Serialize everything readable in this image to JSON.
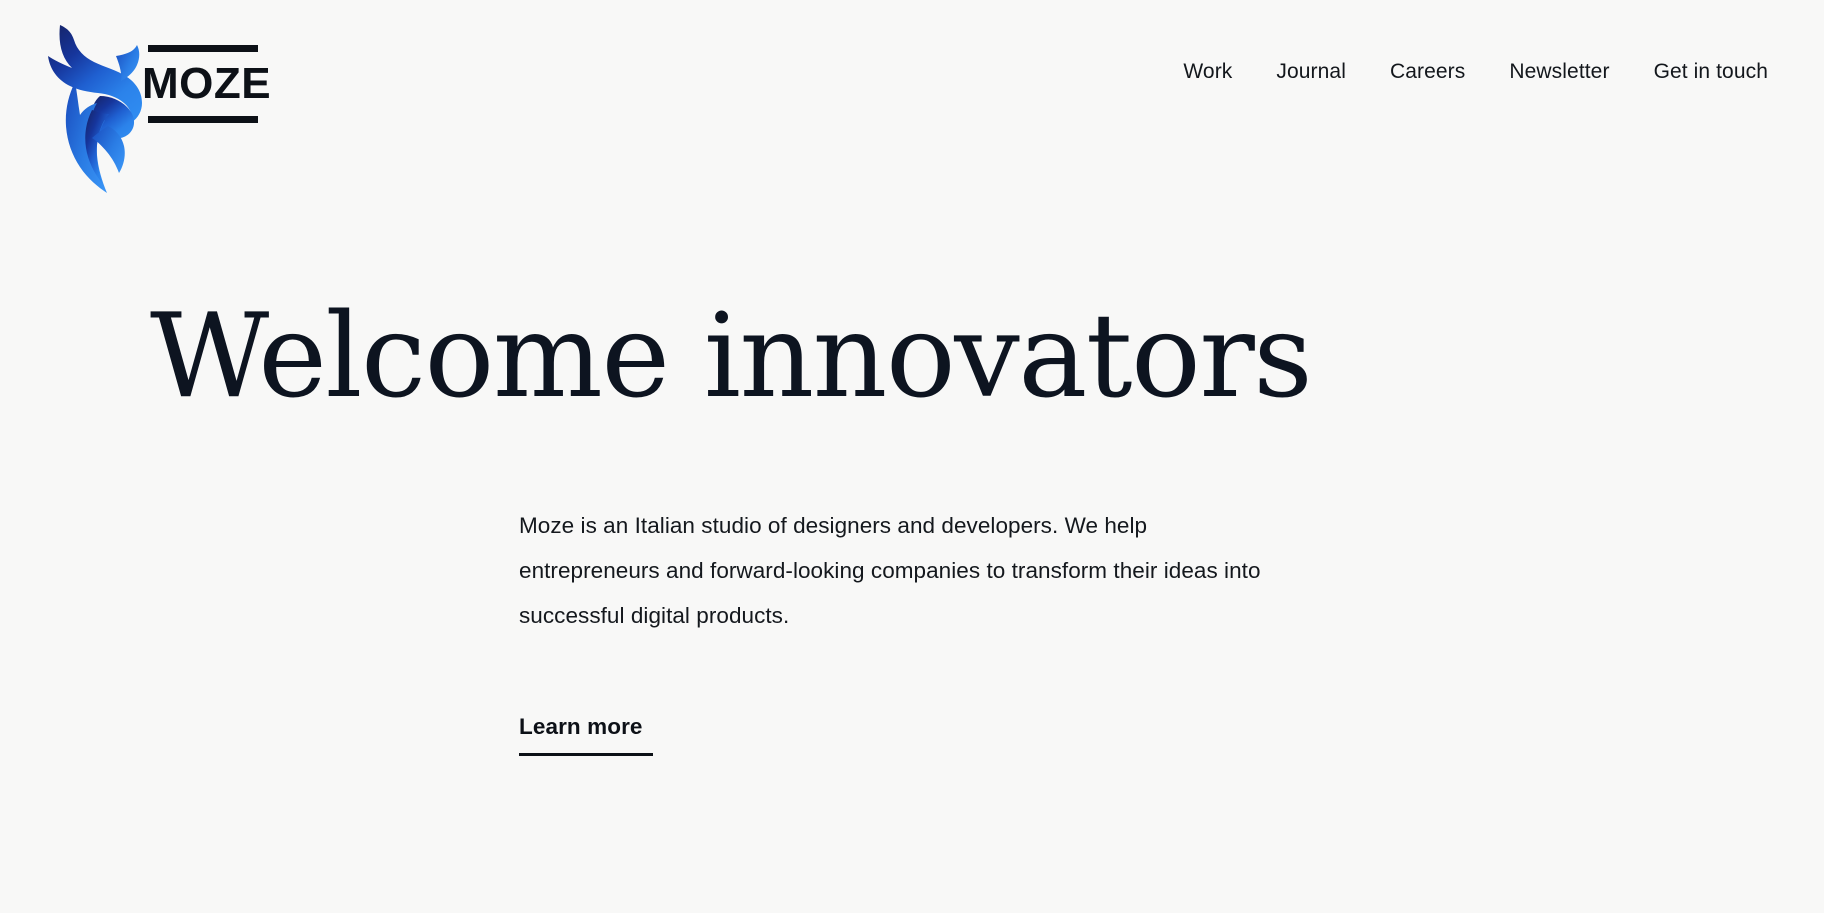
{
  "theme": {
    "background": "#f8f8f7",
    "text": "#14181d",
    "heading": "#0d1420",
    "accent": "#1b64d6",
    "brand_gradient_start": "#14307e",
    "brand_gradient_end": "#2f8bf0",
    "rule": "#0d1117"
  },
  "header": {
    "brand": {
      "name": "MOZE",
      "mark_icon": "bull-flame-logo-icon",
      "wordmark_icon": "moze-wordmark-icon",
      "home_link_label": "MOZE"
    },
    "nav": {
      "items": [
        {
          "label": "Work",
          "name": "nav-link-work"
        },
        {
          "label": "Journal",
          "name": "nav-link-journal"
        },
        {
          "label": "Careers",
          "name": "nav-link-careers"
        },
        {
          "label": "Newsletter",
          "name": "nav-link-newsletter"
        },
        {
          "label": "Get in touch",
          "name": "nav-link-get-in-touch"
        }
      ]
    }
  },
  "hero": {
    "title": "Welcome innovators",
    "paragraph": "Moze is an Italian studio of designers and developers. We help entrepreneurs and forward-looking companies to transform their ideas into successful digital products.",
    "cta_label": "Learn more"
  }
}
